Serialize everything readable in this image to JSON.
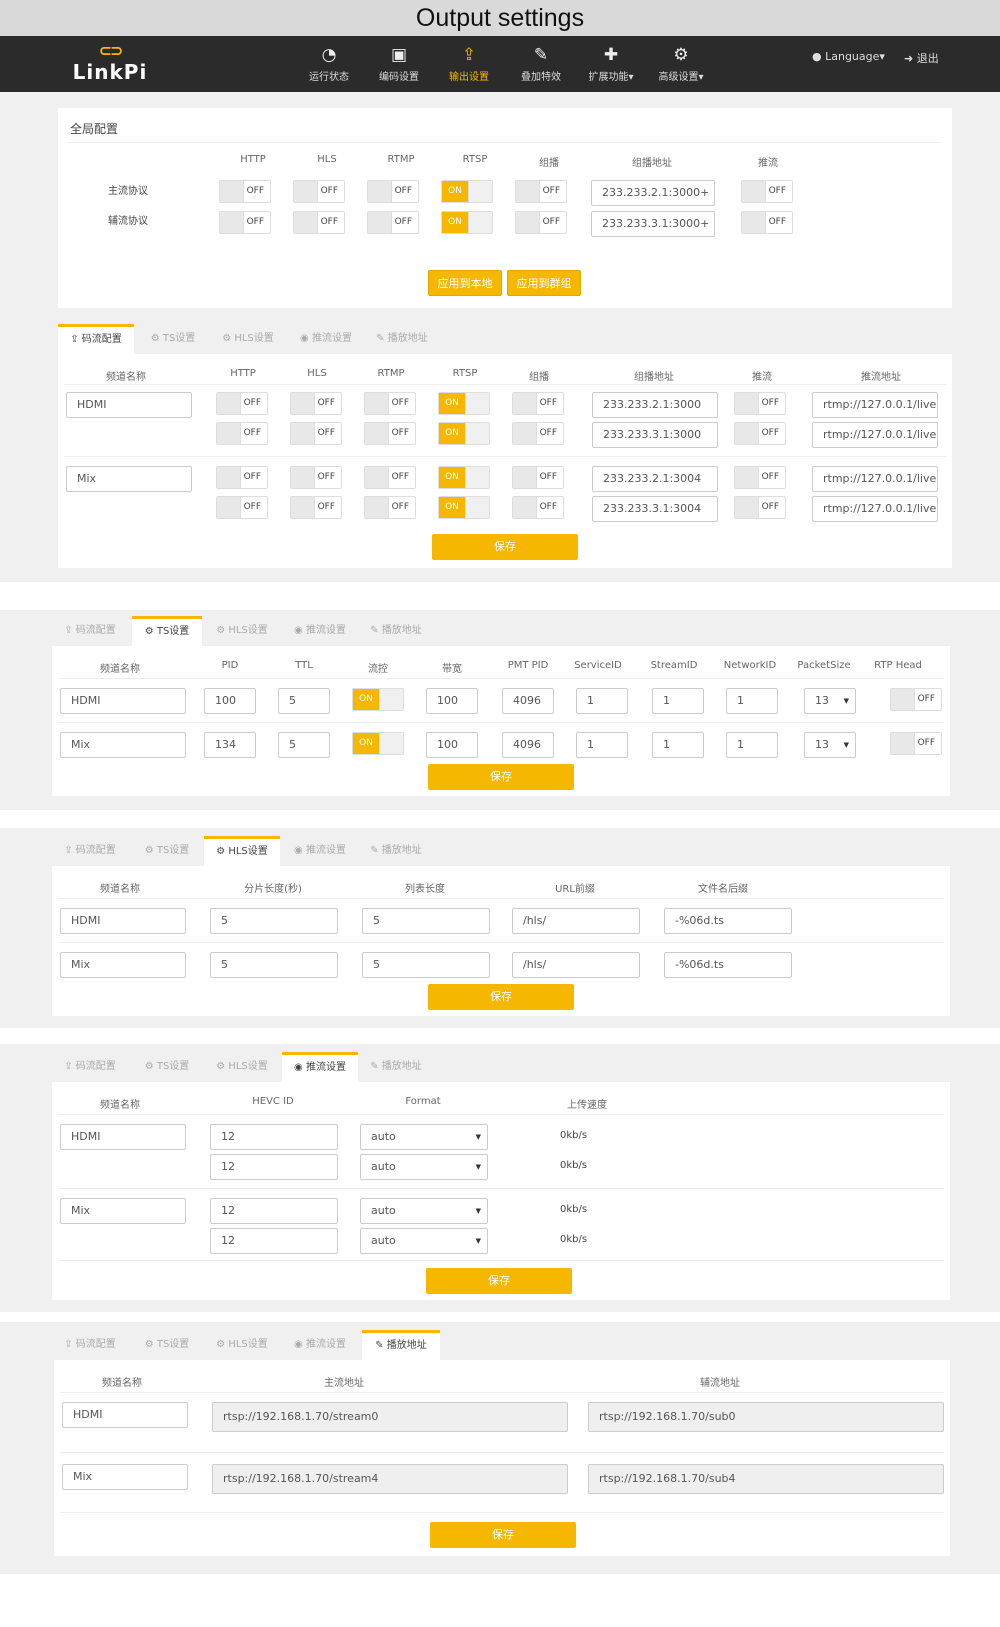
{
  "banner": "Output settings",
  "nav": {
    "logo_text": "LinkPi",
    "logo_icon": "chain-link-icon",
    "items": [
      {
        "label": "运行状态",
        "icon": "dashboard-icon"
      },
      {
        "label": "编码设置",
        "icon": "image-icon"
      },
      {
        "label": "输出设置",
        "icon": "upload-icon",
        "active": true
      },
      {
        "label": "叠加特效",
        "icon": "magic-wand-icon"
      },
      {
        "label": "扩展功能▾",
        "icon": "puzzle-icon"
      },
      {
        "label": "高级设置▾",
        "icon": "gears-icon"
      }
    ],
    "language": "Language▾",
    "logout": "退出"
  },
  "tabs": [
    "码流配置",
    "TS设置",
    "HLS设置",
    "推流设置",
    "播放地址"
  ],
  "global": {
    "title": "全局配置",
    "headers": [
      "HTTP",
      "HLS",
      "RTMP",
      "RTSP",
      "组播",
      "组播地址",
      "推流"
    ],
    "rows": [
      {
        "label": "主流协议",
        "toggles": [
          "OFF",
          "OFF",
          "OFF",
          "ON",
          "OFF"
        ],
        "addr": "233.233.2.1:3000+",
        "push": "OFF"
      },
      {
        "label": "辅流协议",
        "toggles": [
          "OFF",
          "OFF",
          "OFF",
          "ON",
          "OFF"
        ],
        "addr": "233.233.3.1:3000+",
        "push": "OFF"
      }
    ],
    "btn_local": "应用到本地",
    "btn_group": "应用到群组"
  },
  "stream": {
    "headers": [
      "频道名称",
      "HTTP",
      "HLS",
      "RTMP",
      "RTSP",
      "组播",
      "组播地址",
      "推流",
      "推流地址"
    ],
    "channels": [
      {
        "name": "HDMI",
        "rows": [
          {
            "toggles": [
              "OFF",
              "OFF",
              "OFF",
              "ON",
              "OFF"
            ],
            "addr": "233.233.2.1:3000",
            "push": "OFF",
            "url": "rtmp://127.0.0.1/live"
          },
          {
            "toggles": [
              "OFF",
              "OFF",
              "OFF",
              "ON",
              "OFF"
            ],
            "addr": "233.233.3.1:3000",
            "push": "OFF",
            "url": "rtmp://127.0.0.1/live"
          }
        ]
      },
      {
        "name": "Mix",
        "rows": [
          {
            "toggles": [
              "OFF",
              "OFF",
              "OFF",
              "ON",
              "OFF"
            ],
            "addr": "233.233.2.1:3004",
            "push": "OFF",
            "url": "rtmp://127.0.0.1/live"
          },
          {
            "toggles": [
              "OFF",
              "OFF",
              "OFF",
              "ON",
              "OFF"
            ],
            "addr": "233.233.3.1:3004",
            "push": "OFF",
            "url": "rtmp://127.0.0.1/live"
          }
        ]
      }
    ],
    "save": "保存"
  },
  "ts": {
    "headers": [
      "频道名称",
      "PID",
      "TTL",
      "流控",
      "带宽",
      "PMT PID",
      "ServiceID",
      "StreamID",
      "NetworkID",
      "PacketSize",
      "RTP Head"
    ],
    "rows": [
      {
        "name": "HDMI",
        "pid": "100",
        "ttl": "5",
        "flow": "ON",
        "bw": "100",
        "pmt": "4096",
        "service": "1",
        "stream": "1",
        "network": "1",
        "packet": "13",
        "rtp": "OFF"
      },
      {
        "name": "Mix",
        "pid": "134",
        "ttl": "5",
        "flow": "ON",
        "bw": "100",
        "pmt": "4096",
        "service": "1",
        "stream": "1",
        "network": "1",
        "packet": "13",
        "rtp": "OFF"
      }
    ],
    "save": "保存"
  },
  "hls": {
    "headers": [
      "频道名称",
      "分片长度(秒)",
      "列表长度",
      "URL前缀",
      "文件名后缀"
    ],
    "rows": [
      {
        "name": "HDMI",
        "seg": "5",
        "list": "5",
        "url": "/hls/",
        "suffix": "-%06d.ts"
      },
      {
        "name": "Mix",
        "seg": "5",
        "list": "5",
        "url": "/hls/",
        "suffix": "-%06d.ts"
      }
    ],
    "save": "保存"
  },
  "push": {
    "headers": [
      "频道名称",
      "HEVC ID",
      "Format",
      "上传速度"
    ],
    "channels": [
      {
        "name": "HDMI",
        "rows": [
          {
            "hevc": "12",
            "format": "auto",
            "rate": "0kb/s"
          },
          {
            "hevc": "12",
            "format": "auto",
            "rate": "0kb/s"
          }
        ]
      },
      {
        "name": "Mix",
        "rows": [
          {
            "hevc": "12",
            "format": "auto",
            "rate": "0kb/s"
          },
          {
            "hevc": "12",
            "format": "auto",
            "rate": "0kb/s"
          }
        ]
      }
    ],
    "save": "保存"
  },
  "play": {
    "headers": [
      "频道名称",
      "主流地址",
      "辅流地址"
    ],
    "rows": [
      {
        "name": "HDMI",
        "main": "rtsp://192.168.1.70/stream0",
        "sub": "rtsp://192.168.1.70/sub0"
      },
      {
        "name": "Mix",
        "main": "rtsp://192.168.1.70/stream4",
        "sub": "rtsp://192.168.1.70/sub4"
      }
    ],
    "save": "保存"
  },
  "colors": {
    "accent": "#f5b700",
    "navbar": "#2b2b2b"
  }
}
